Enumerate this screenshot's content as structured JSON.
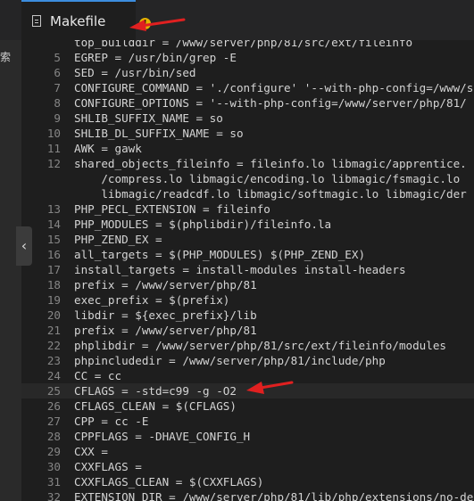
{
  "sidebar": {
    "label": "索",
    "collapse_glyph": "‹"
  },
  "tab": {
    "title": "Makefile",
    "warning_glyph": "!"
  },
  "editor": {
    "lines": [
      {
        "num": "",
        "text": "top_builddir = /www/server/php/81/src/ext/fileinfo"
      },
      {
        "num": "5",
        "text": "EGREP = /usr/bin/grep -E"
      },
      {
        "num": "6",
        "text": "SED = /usr/bin/sed"
      },
      {
        "num": "7",
        "text": "CONFIGURE_COMMAND = './configure' '--with-php-config=/www/s"
      },
      {
        "num": "8",
        "text": "CONFIGURE_OPTIONS = '--with-php-config=/www/server/php/81/"
      },
      {
        "num": "9",
        "text": "SHLIB_SUFFIX_NAME = so"
      },
      {
        "num": "10",
        "text": "SHLIB_DL_SUFFIX_NAME = so"
      },
      {
        "num": "11",
        "text": "AWK = gawk"
      },
      {
        "num": "12",
        "text": "shared_objects_fileinfo = fileinfo.lo libmagic/apprentice."
      },
      {
        "num": "",
        "text": "    /compress.lo libmagic/encoding.lo libmagic/fsmagic.lo"
      },
      {
        "num": "",
        "text": "    libmagic/readcdf.lo libmagic/softmagic.lo libmagic/der"
      },
      {
        "num": "13",
        "text": "PHP_PECL_EXTENSION = fileinfo"
      },
      {
        "num": "14",
        "text": "PHP_MODULES = $(phplibdir)/fileinfo.la"
      },
      {
        "num": "15",
        "text": "PHP_ZEND_EX ="
      },
      {
        "num": "16",
        "text": "all_targets = $(PHP_MODULES) $(PHP_ZEND_EX)"
      },
      {
        "num": "17",
        "text": "install_targets = install-modules install-headers"
      },
      {
        "num": "18",
        "text": "prefix = /www/server/php/81"
      },
      {
        "num": "19",
        "text": "exec_prefix = $(prefix)"
      },
      {
        "num": "20",
        "text": "libdir = ${exec_prefix}/lib"
      },
      {
        "num": "21",
        "text": "prefix = /www/server/php/81"
      },
      {
        "num": "22",
        "text": "phplibdir = /www/server/php/81/src/ext/fileinfo/modules"
      },
      {
        "num": "23",
        "text": "phpincludedir = /www/server/php/81/include/php"
      },
      {
        "num": "24",
        "text": "CC = cc"
      },
      {
        "num": "25",
        "text": "CFLAGS = -std=c99 -g -O2"
      },
      {
        "num": "26",
        "text": "CFLAGS_CLEAN = $(CFLAGS)"
      },
      {
        "num": "27",
        "text": "CPP = cc -E"
      },
      {
        "num": "28",
        "text": "CPPFLAGS = -DHAVE_CONFIG_H"
      },
      {
        "num": "29",
        "text": "CXX ="
      },
      {
        "num": "30",
        "text": "CXXFLAGS ="
      },
      {
        "num": "31",
        "text": "CXXFLAGS_CLEAN = $(CXXFLAGS)"
      },
      {
        "num": "32",
        "text": "EXTENSION_DIR = /www/server/php/81/lib/php/extensions/no-de"
      }
    ],
    "current_line_index": 23
  },
  "colors": {
    "arrow": "#e02020",
    "warning": "#e5b300",
    "accent": "#3c8dde"
  }
}
